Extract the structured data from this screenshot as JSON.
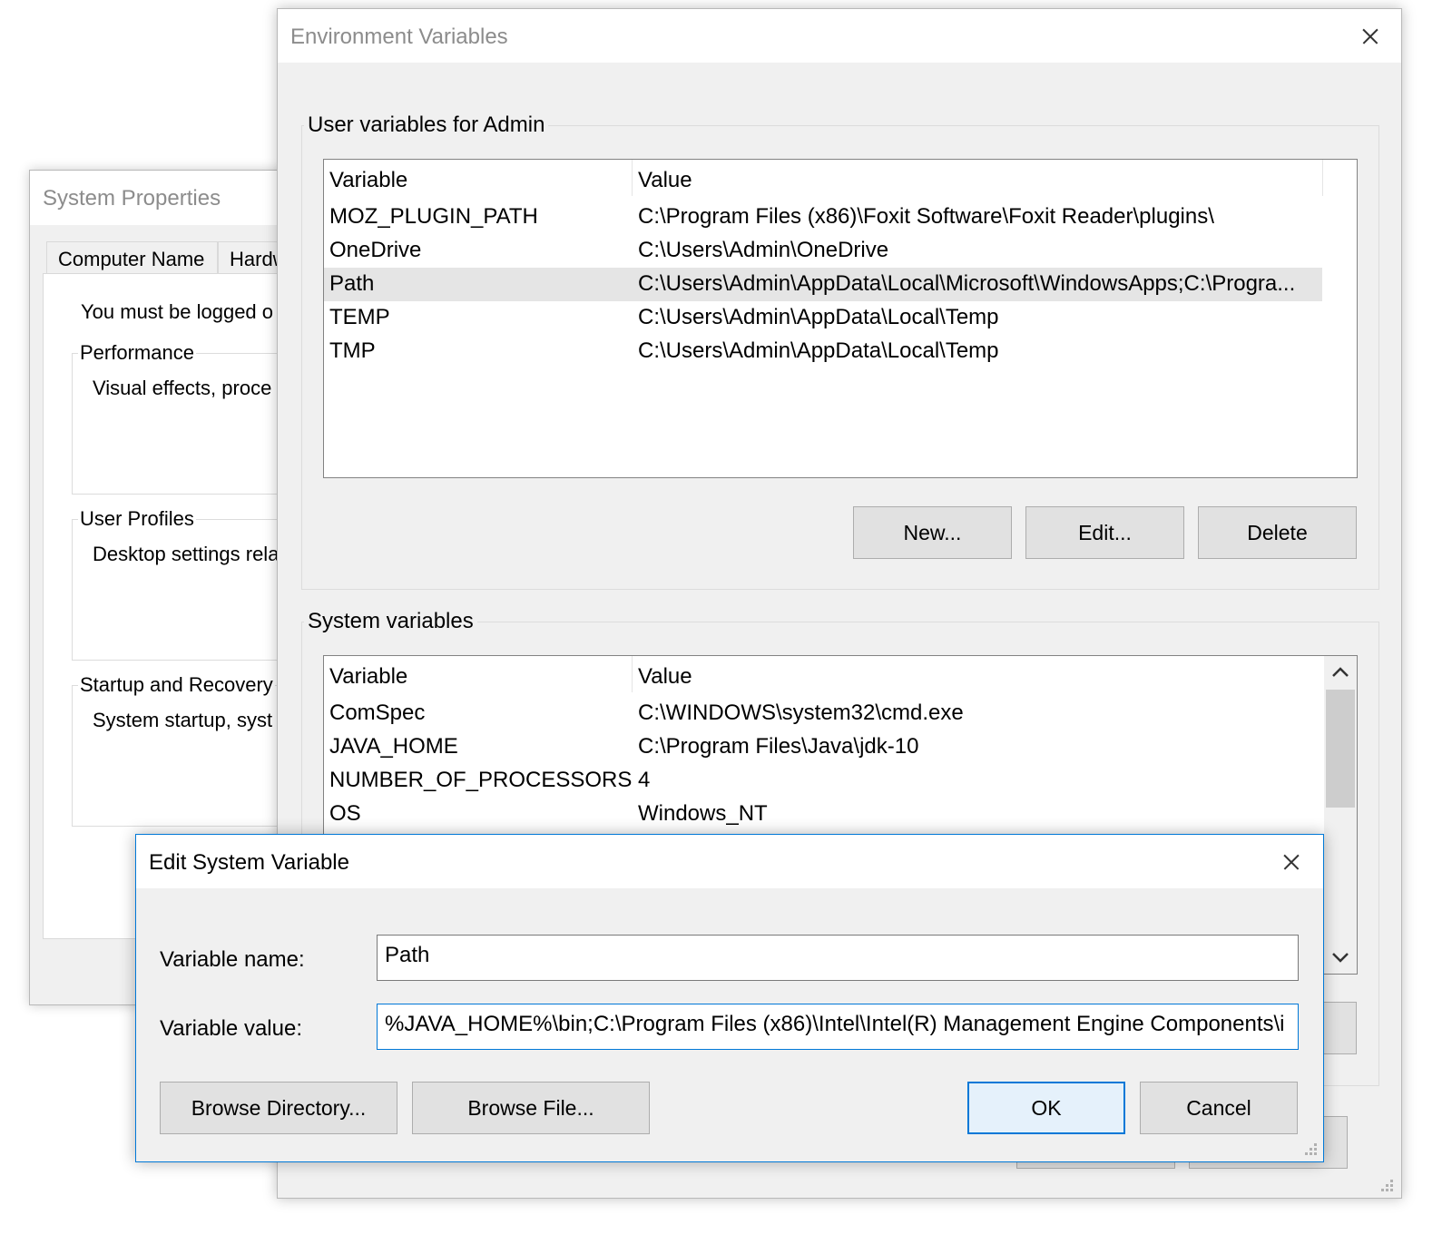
{
  "system_properties": {
    "title": "System Properties",
    "tabs": [
      "Computer Name",
      "Hardw"
    ],
    "logged_on_text": "You must be logged o",
    "performance": {
      "label": "Performance",
      "desc": "Visual effects, proce"
    },
    "user_profiles": {
      "label": "User Profiles",
      "desc": "Desktop settings rela"
    },
    "startup_recovery": {
      "label": "Startup and Recovery",
      "desc": "System startup, syst"
    }
  },
  "env_vars": {
    "title": "Environment Variables",
    "user_section": {
      "label": "User variables for Admin",
      "headers": {
        "variable": "Variable",
        "value": "Value"
      },
      "rows": [
        {
          "name": "MOZ_PLUGIN_PATH",
          "value": "C:\\Program Files (x86)\\Foxit Software\\Foxit Reader\\plugins\\"
        },
        {
          "name": "OneDrive",
          "value": "C:\\Users\\Admin\\OneDrive"
        },
        {
          "name": "Path",
          "value": "C:\\Users\\Admin\\AppData\\Local\\Microsoft\\WindowsApps;C:\\Progra..."
        },
        {
          "name": "TEMP",
          "value": "C:\\Users\\Admin\\AppData\\Local\\Temp"
        },
        {
          "name": "TMP",
          "value": "C:\\Users\\Admin\\AppData\\Local\\Temp"
        }
      ],
      "buttons": {
        "new": "New...",
        "edit": "Edit...",
        "delete": "Delete"
      }
    },
    "system_section": {
      "label": "System variables",
      "headers": {
        "variable": "Variable",
        "value": "Value"
      },
      "rows": [
        {
          "name": "ComSpec",
          "value": "C:\\WINDOWS\\system32\\cmd.exe"
        },
        {
          "name": "JAVA_HOME",
          "value": "C:\\Program Files\\Java\\jdk-10"
        },
        {
          "name": "NUMBER_OF_PROCESSORS",
          "value": "4"
        },
        {
          "name": "OS",
          "value": "Windows_NT"
        }
      ]
    }
  },
  "edit_dialog": {
    "title": "Edit System Variable",
    "name_label": "Variable name:",
    "name_value": "Path",
    "value_label": "Variable value:",
    "value_value": "%JAVA_HOME%\\bin;C:\\Program Files (x86)\\Intel\\Intel(R) Management Engine Components\\i",
    "buttons": {
      "browse_directory": "Browse Directory...",
      "browse_file": "Browse File...",
      "ok": "OK",
      "cancel": "Cancel"
    }
  },
  "colors": {
    "accent": "#0078d7",
    "dialog_bg": "#f0f0f0",
    "button_bg": "#e1e1e1",
    "selected_row": "#e5e5e5"
  }
}
